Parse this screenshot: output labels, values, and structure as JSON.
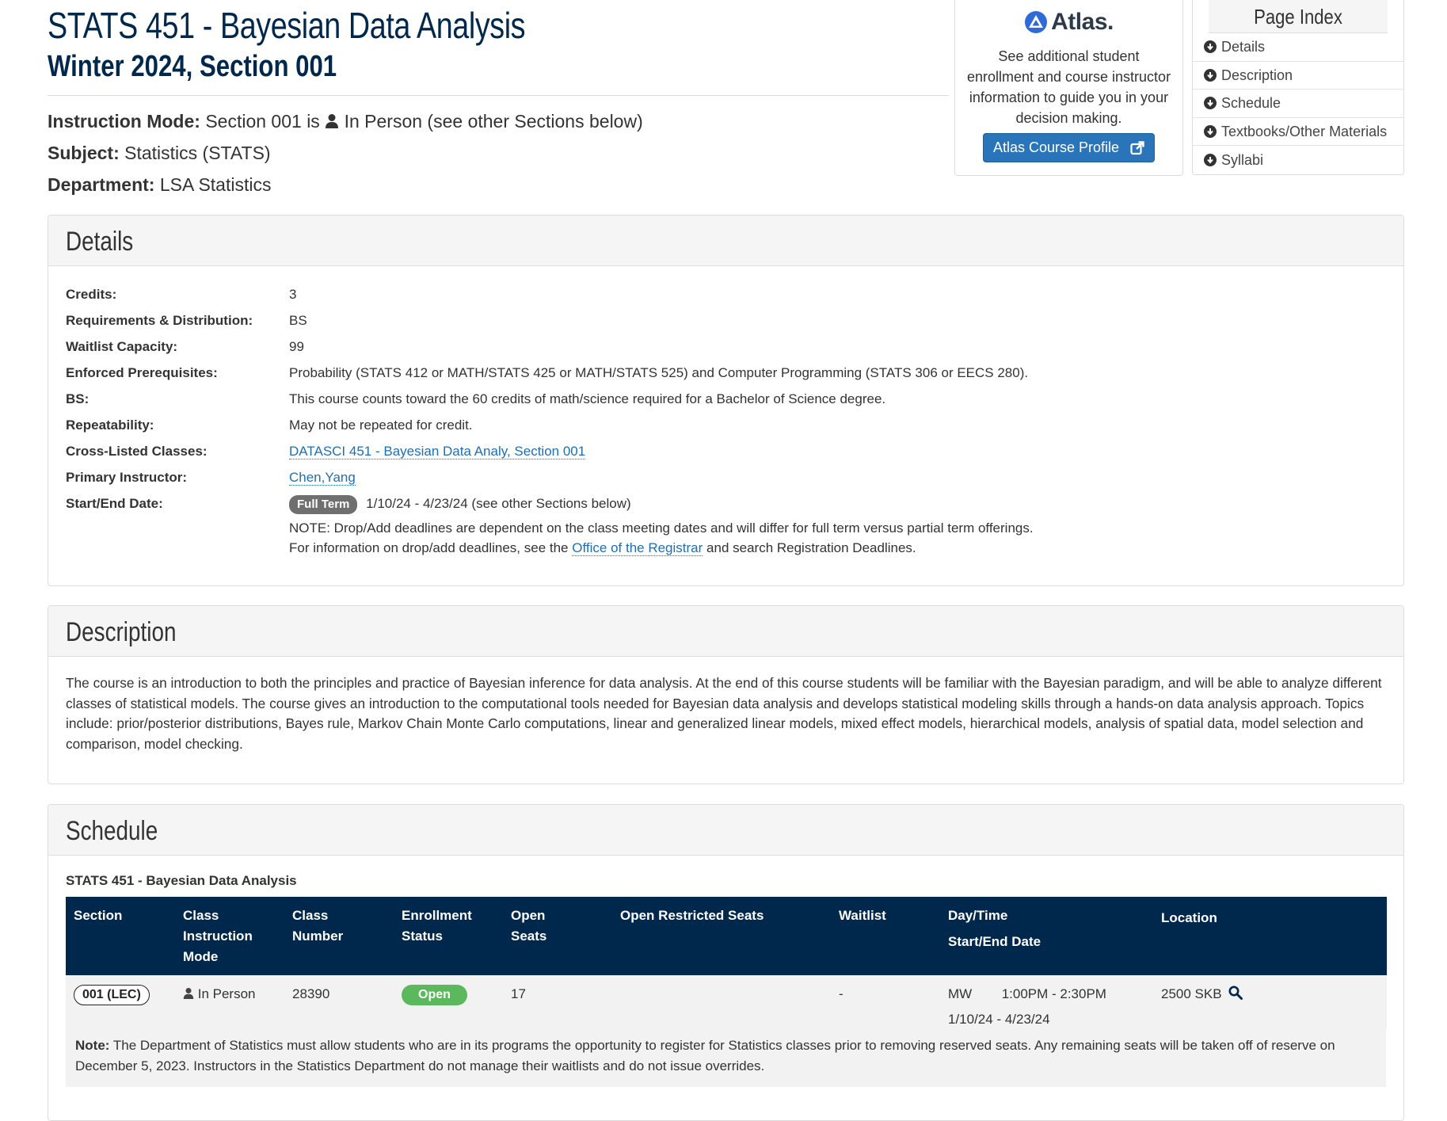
{
  "header": {
    "course_title": "STATS 451 - Bayesian Data Analysis",
    "term_title": "Winter 2024, Section 001",
    "instruction_mode_label": "Instruction Mode:",
    "instruction_mode_pre": "Section 001 is",
    "instruction_mode_value": "In Person (see other Sections below)",
    "subject_label": "Subject:",
    "subject_value": "Statistics (STATS)",
    "department_label": "Department:",
    "department_value": "LSA Statistics"
  },
  "atlas": {
    "logo_text": "Atlas.",
    "text": "See additional student enrollment and course instructor information to guide you in your decision making.",
    "button_label": "Atlas Course Profile",
    "accent": "#2a74b9"
  },
  "page_index": {
    "title": "Page Index",
    "items": [
      {
        "label": "Details"
      },
      {
        "label": "Description"
      },
      {
        "label": "Schedule"
      },
      {
        "label": "Textbooks/Other Materials"
      },
      {
        "label": "Syllabi"
      }
    ]
  },
  "details": {
    "title": "Details",
    "rows": [
      {
        "label": "Credits:",
        "value": "3"
      },
      {
        "label": "Requirements & Distribution:",
        "value": "BS"
      },
      {
        "label": "Waitlist Capacity:",
        "value": "99"
      },
      {
        "label": "Enforced Prerequisites:",
        "value": "Probability (STATS 412 or MATH/STATS 425 or MATH/STATS 525) and Computer Programming (STATS 306 or EECS 280)."
      },
      {
        "label": "BS:",
        "value": "This course counts toward the 60 credits of math/science required for a Bachelor of Science degree."
      },
      {
        "label": "Repeatability:",
        "value": "May not be repeated for credit."
      },
      {
        "label": "Cross-Listed Classes:",
        "value": "DATASCI 451 - Bayesian Data Analy, Section 001"
      },
      {
        "label": "Primary Instructor:",
        "value": "Chen,Yang"
      },
      {
        "label": "Start/End Date:",
        "badge": "Full Term",
        "value": "1/10/24 - 4/23/24 (see other Sections below)"
      }
    ],
    "note_line1": "NOTE: Drop/Add deadlines are dependent on the class meeting dates and will differ for full term versus partial term offerings.",
    "note_line2_pre": "For information on drop/add deadlines, see the",
    "note_line2_link": "Office of the Registrar",
    "note_line2_post": "and search Registration Deadlines."
  },
  "description": {
    "title": "Description",
    "text": "The course is an introduction to both the principles and practice of Bayesian inference for data analysis. At the end of this course students will be familiar with the Bayesian paradigm, and will be able to analyze different classes of statistical models. The course gives an introduction to the computational tools needed for Bayesian data analysis and develops statistical modeling skills through a hands-on data analysis approach. Topics include: prior/posterior distributions, Bayes rule, Markov Chain Monte Carlo computations, linear and generalized linear models, mixed effect models, hierarchical models, analysis of spatial data, model selection and comparison, model checking."
  },
  "schedule": {
    "title": "Schedule",
    "subtitle": "STATS 451 - Bayesian Data Analysis",
    "columns": {
      "section": "Section",
      "mode_1": "Class",
      "mode_2": "Instruction",
      "mode_3": "Mode",
      "number_1": "Class",
      "number_2": "Number",
      "enroll_1": "Enrollment",
      "enroll_2": "Status",
      "open_1": "Open",
      "open_2": "Seats",
      "restricted": "Open Restricted Seats",
      "waitlist": "Waitlist",
      "daytime": "Day/Time",
      "startend": "Start/End Date",
      "location": "Location"
    },
    "row": {
      "section": "001 (LEC)",
      "mode": "In Person",
      "number": "28390",
      "status": "Open",
      "open_seats": "17",
      "restricted": "",
      "waitlist": "-",
      "days": "MW",
      "time": "1:00PM - 2:30PM",
      "dates": "1/10/24 - 4/23/24",
      "location": "2500 SKB"
    },
    "note_label": "Note:",
    "note_text": "The Department of Statistics must allow students who are in its programs the opportunity to register for Statistics classes prior to removing reserved seats. Any remaining seats will be taken off of reserve on December 5, 2023. Instructors in the Statistics Department do not manage their waitlists and do not issue overrides.",
    "header_bg": "#00274c",
    "open_color": "#5cb85c"
  }
}
